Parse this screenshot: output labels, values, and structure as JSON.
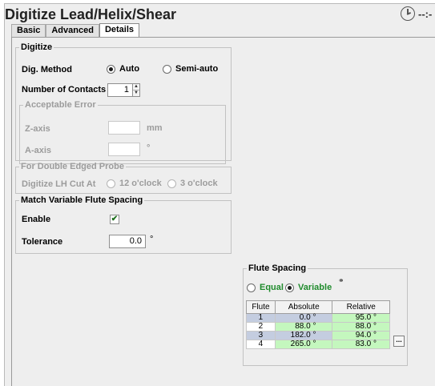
{
  "window": {
    "title": "Digitize Lead/Helix/Shear",
    "clock_text": "--:-"
  },
  "tabs": [
    {
      "label": "Basic",
      "active": false
    },
    {
      "label": "Advanced",
      "active": false
    },
    {
      "label": "Details",
      "active": true
    }
  ],
  "digitize": {
    "legend": "Digitize",
    "dig_method_label": "Dig. Method",
    "method_options": [
      {
        "label": "Auto",
        "selected": true
      },
      {
        "label": "Semi-auto",
        "selected": false
      }
    ],
    "contacts_label": "Number of Contacts",
    "contacts_value": "1",
    "acceptable_error": {
      "legend": "Acceptable Error",
      "z_label": "Z-axis",
      "z_value": "",
      "z_unit": "mm",
      "a_label": "A-axis",
      "a_value": "",
      "a_unit": "°"
    }
  },
  "double_edged": {
    "legend": "For Double Edged Probe",
    "cut_label": "Digitize LH Cut At",
    "options": [
      {
        "label": "12 o'clock",
        "selected": false
      },
      {
        "label": "3 o'clock",
        "selected": false
      }
    ]
  },
  "match_flute": {
    "legend": "Match Variable Flute Spacing",
    "enable_label": "Enable",
    "enable_checked": true,
    "check_glyph": "✔",
    "tolerance_label": "Tolerance",
    "tolerance_value": "0.0",
    "tolerance_unit": "°"
  },
  "flute_spacing": {
    "legend": "Flute Spacing",
    "options": [
      {
        "label": "Equal",
        "selected": false
      },
      {
        "label": "Variable",
        "selected": true
      }
    ],
    "link_icon": "link-icon",
    "columns": [
      "Flute",
      "Absolute",
      "Relative"
    ],
    "rows": [
      {
        "flute": "1",
        "absolute": "0.0 °",
        "relative": "95.0 °"
      },
      {
        "flute": "2",
        "absolute": "88.0 °",
        "relative": "88.0 °"
      },
      {
        "flute": "3",
        "absolute": "182.0 °",
        "relative": "94.0 °"
      },
      {
        "flute": "4",
        "absolute": "265.0 °",
        "relative": "83.0 °"
      }
    ],
    "more_button": "..."
  }
}
